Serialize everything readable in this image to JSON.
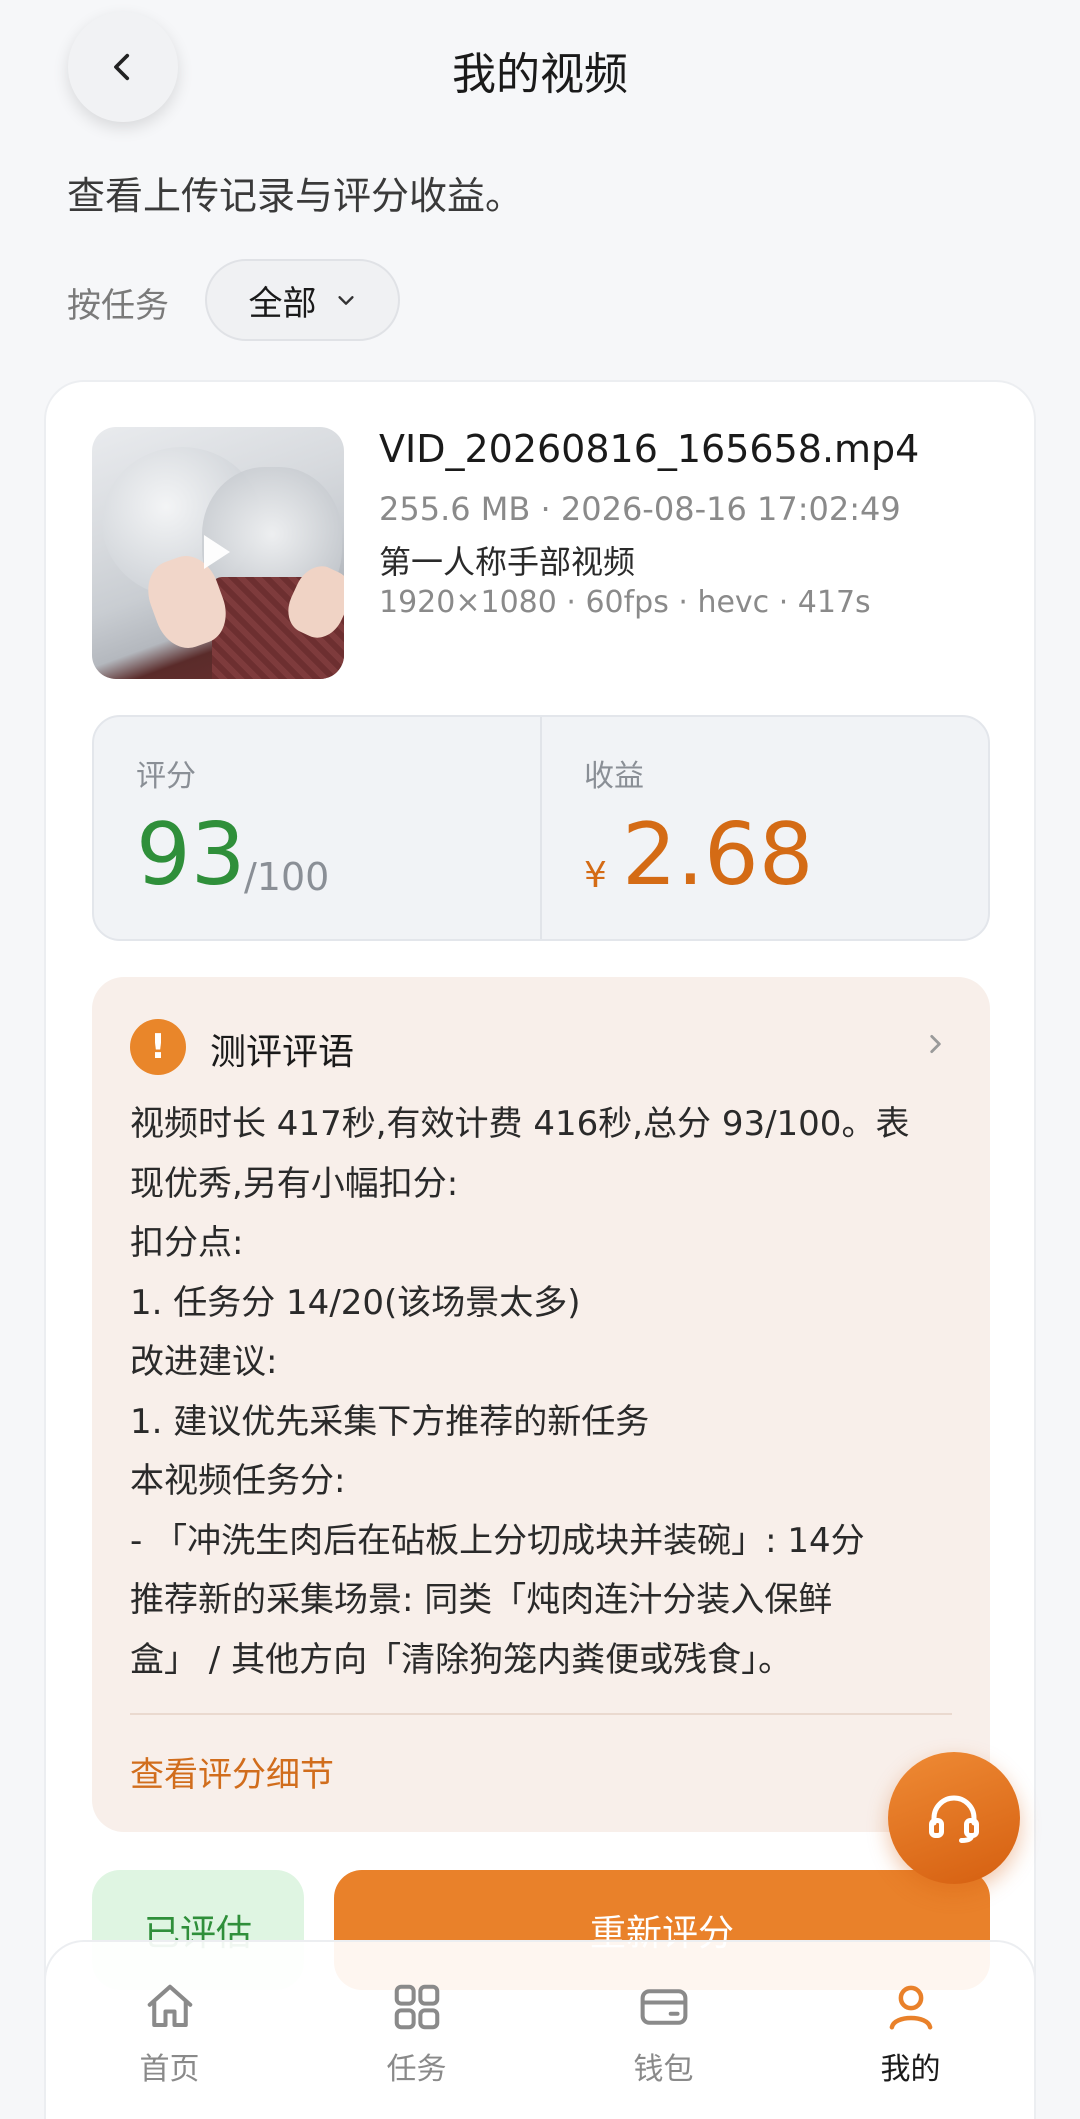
{
  "header": {
    "title": "我的视频"
  },
  "subtitle": "查看上传记录与评分收益。",
  "filter": {
    "label": "按任务",
    "selected": "全部"
  },
  "video": {
    "filename": "VID_20260816_165658.mp4",
    "size_and_time": "255.6 MB · 2026-08-16 17:02:49",
    "task_type": "第一人称手部视频",
    "specs": "1920×1080 · 60fps · hevc · 417s"
  },
  "stats": {
    "score_label": "评分",
    "score_value": "93",
    "score_max": "/100",
    "earnings_label": "收益",
    "currency": "¥",
    "earnings_value": "2.68"
  },
  "review": {
    "title": "测评评语",
    "lines": [
      "视频时长 417秒,有效计费 416秒,总分 93/100。表",
      "现优秀,另有小幅扣分:",
      "扣分点:",
      "1. 任务分 14/20(该场景太多)",
      "改进建议:",
      "1. 建议优先采集下方推荐的新任务",
      "本视频任务分:",
      "- 「冲洗生肉后在砧板上分切成块并装碗」: 14分",
      "推荐新的采集场景: 同类「炖肉连汁分装入保鲜",
      "盒」 / 其他方向「清除狗笼内粪便或残食」。"
    ],
    "details_link": "查看评分细节"
  },
  "actions": {
    "status_badge": "已评估",
    "rescore_label": "重新评分"
  },
  "nav": {
    "items": [
      {
        "label": "首页",
        "icon": "home-icon"
      },
      {
        "label": "任务",
        "icon": "grid-icon"
      },
      {
        "label": "钱包",
        "icon": "wallet-icon"
      },
      {
        "label": "我的",
        "icon": "user-icon"
      }
    ],
    "active": "我的"
  },
  "colors": {
    "accent": "#e9812a",
    "score_green": "#2f8f3a",
    "earnings_orange": "#d46b15",
    "review_bg": "#f8efea"
  }
}
